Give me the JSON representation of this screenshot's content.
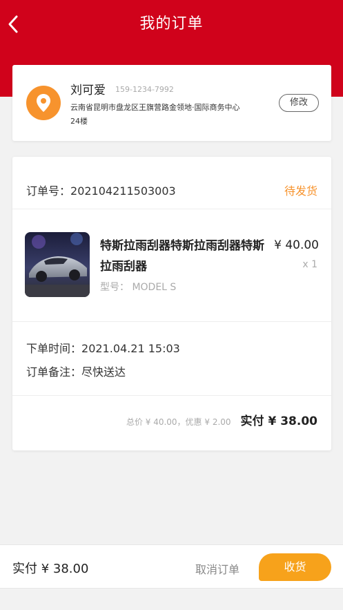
{
  "header": {
    "title": "我的订单",
    "back_icon": "chevron-left-icon",
    "bg_color": "#d0021b"
  },
  "address": {
    "name": "刘可爱",
    "phone": "159-1234-7992",
    "line1": "云南省昆明市盘龙区王旗营路金领地·国际商务中心",
    "line2": "24楼",
    "edit_label": "修改",
    "icon": "location-pin-icon"
  },
  "order": {
    "number_label": "订单号：",
    "number": "202104211503003",
    "status": "待发货",
    "status_color": "#f7932d",
    "product": {
      "name": "特斯拉雨刮器特斯拉雨刮器特斯拉雨刮器",
      "price": "¥ 40.00",
      "quantity": "x 1",
      "model": "型号： MODEL S",
      "image": "car-thumbnail"
    },
    "time_label": "下单时间：",
    "time": "2021.04.21 15:03",
    "note_label": "订单备注：",
    "note": "尽快送达",
    "summary": "总价 ¥ 40.00，优惠 ¥ 2.00",
    "paid": "实付 ¥ 38.00"
  },
  "bottom": {
    "paid": "实付 ¥ 38.00",
    "cancel_label": "取消订单",
    "receive_label": "收货",
    "accent_color": "#f7a21b"
  }
}
